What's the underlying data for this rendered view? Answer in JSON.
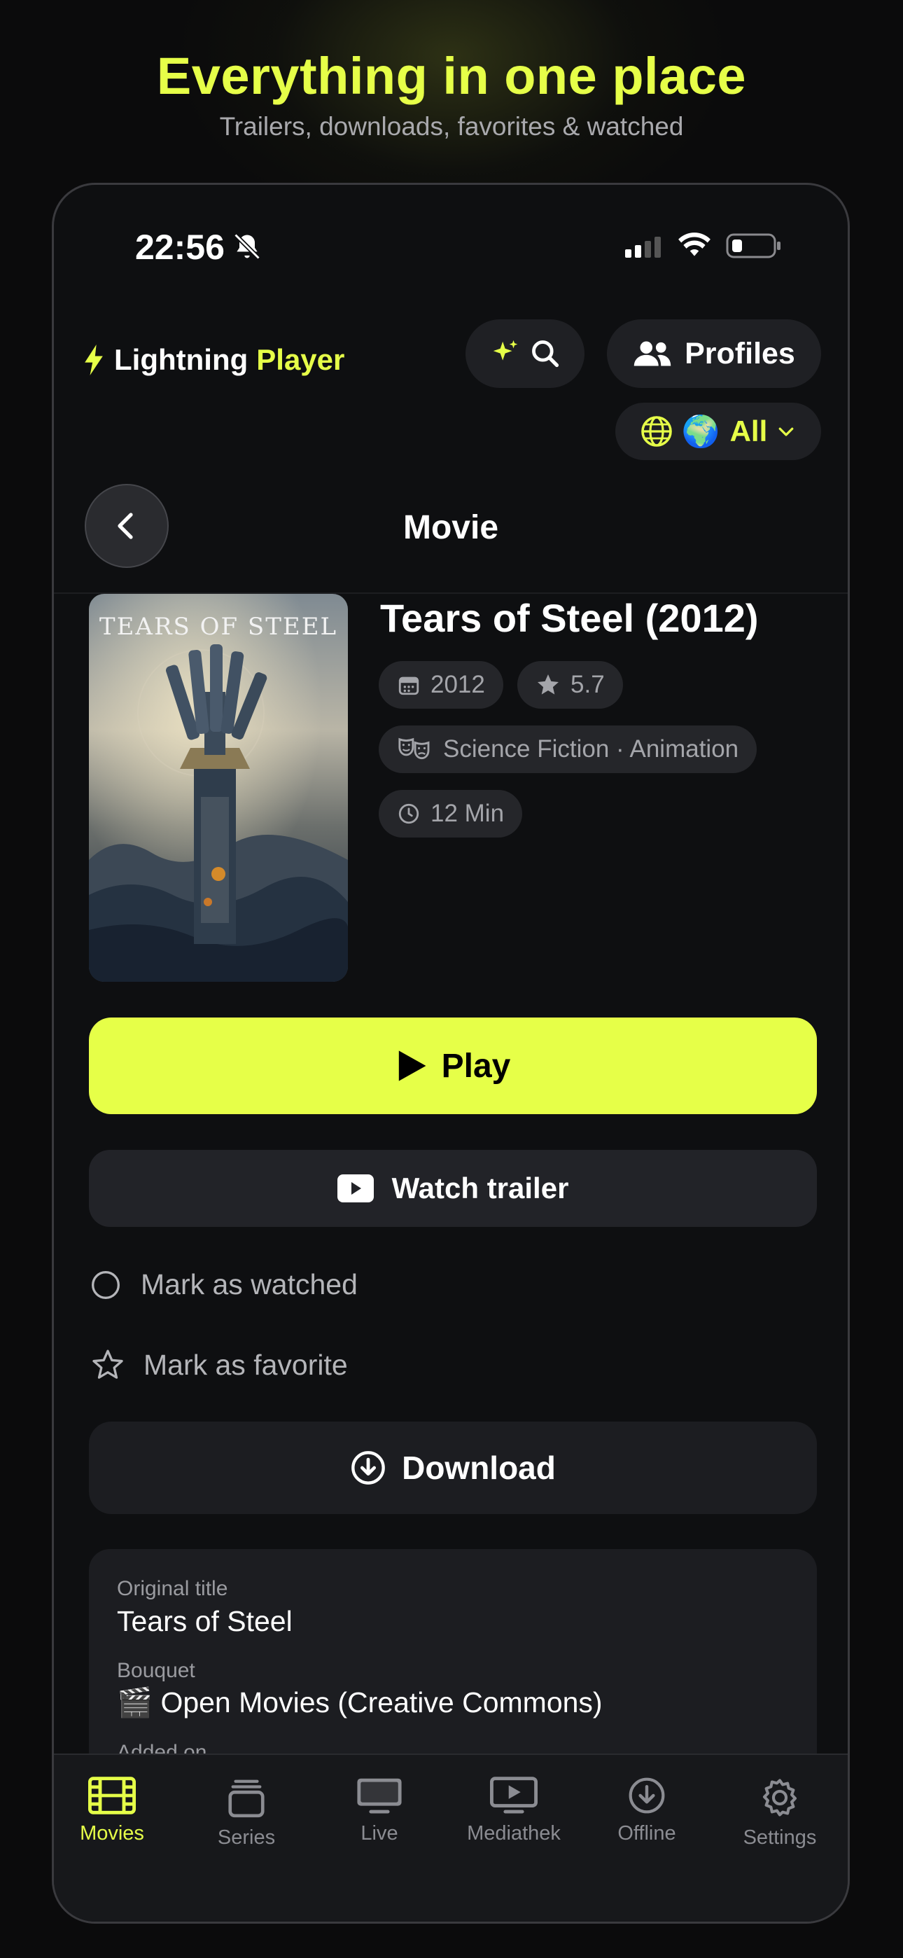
{
  "promo": {
    "headline": "Everything in one place",
    "subline": "Trailers, downloads, favorites & watched"
  },
  "status_bar": {
    "time": "22:56",
    "icons": [
      "bell-slash-icon",
      "signal-icon",
      "wifi-icon",
      "battery-icon"
    ]
  },
  "header": {
    "logo_word1": "Lightning",
    "logo_word2": "Player",
    "profiles_label": "Profiles",
    "language_flag": "🌍",
    "language_label": "All"
  },
  "nav": {
    "title": "Movie"
  },
  "movie": {
    "poster_text": "TEARS OF STEEL",
    "title": "Tears of Steel (2012)",
    "year": "2012",
    "rating": "5.7",
    "genres": "Science Fiction · Animation",
    "duration": "12 Min"
  },
  "actions": {
    "play": "Play",
    "trailer": "Watch trailer",
    "mark_watched": "Mark as watched",
    "mark_favorite": "Mark as favorite",
    "download": "Download"
  },
  "details": {
    "original_title_label": "Original title",
    "original_title": "Tears of Steel",
    "bouquet_label": "Bouquet",
    "bouquet": "🎬 Open Movies (Creative Commons)",
    "added_label": "Added on"
  },
  "tabs": [
    {
      "label": "Movies",
      "icon": "film-icon",
      "active": true
    },
    {
      "label": "Series",
      "icon": "stack-icon",
      "active": false
    },
    {
      "label": "Live",
      "icon": "tv-icon",
      "active": false
    },
    {
      "label": "Mediathek",
      "icon": "play-screen-icon",
      "active": false
    },
    {
      "label": "Offline",
      "icon": "download-icon",
      "active": false
    },
    {
      "label": "Settings",
      "icon": "gear-icon",
      "active": false
    }
  ],
  "colors": {
    "accent": "#e6ff48",
    "background": "#0b0b0c",
    "surface": "#1c1d21"
  }
}
